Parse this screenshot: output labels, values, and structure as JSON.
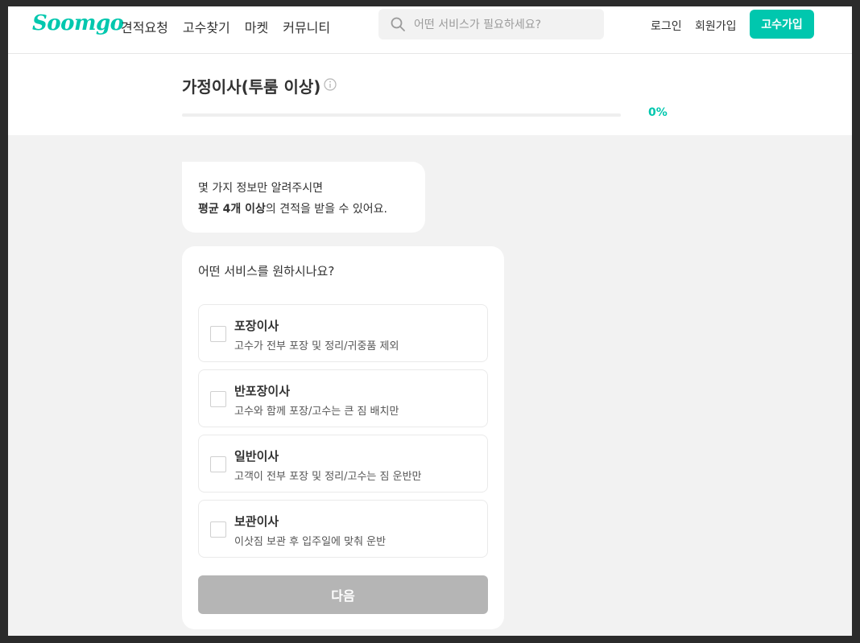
{
  "header": {
    "logo": "Soomgo",
    "nav": [
      "견적요청",
      "고수찾기",
      "마켓",
      "커뮤니티"
    ],
    "search_placeholder": "어떤 서비스가 필요하세요?",
    "login": "로그인",
    "signup": "회원가입",
    "pro_signup": "고수가입"
  },
  "title": {
    "text": "가정이사(투룸 이상)",
    "progress_percent": 0,
    "progress_label": "0%"
  },
  "intro": {
    "line1": "몇 가지 정보만 알려주시면",
    "line2_bold": "평균 4개 이상",
    "line2_rest": "의 견적을 받을 수 있어요."
  },
  "form": {
    "question": "어떤 서비스를 원하시나요?",
    "options": [
      {
        "title": "포장이사",
        "desc": "고수가 전부 포장 및 정리/귀중품 제외",
        "checked": false
      },
      {
        "title": "반포장이사",
        "desc": "고수와 함께 포장/고수는 큰 짐 배치만",
        "checked": false
      },
      {
        "title": "일반이사",
        "desc": "고객이 전부 포장 및 정리/고수는 짐 운반만",
        "checked": false
      },
      {
        "title": "보관이사",
        "desc": "이삿짐 보관 후 입주일에 맞춰 운반",
        "checked": false
      }
    ],
    "next_label": "다음"
  },
  "colors": {
    "brand": "#00c7ae",
    "disabled_button": "#b5b5b5",
    "background": "#f2f2f2"
  }
}
